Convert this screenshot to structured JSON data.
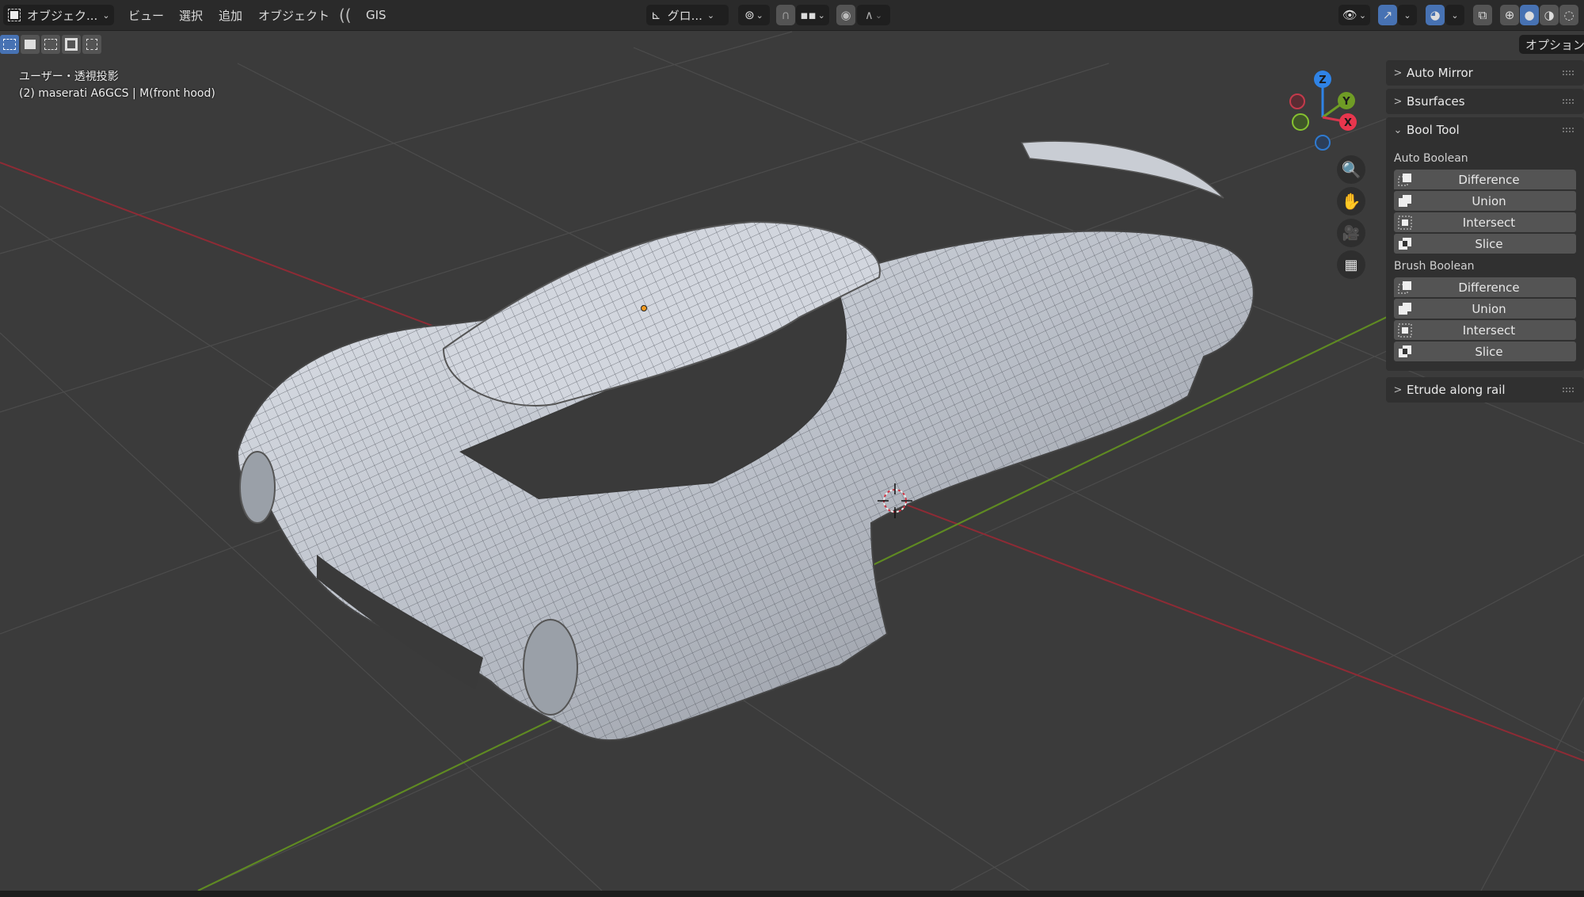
{
  "header": {
    "mode_selector": {
      "icon": "object-mode-icon",
      "label": "オブジェク...",
      "dropdown": true
    },
    "menus": [
      "ビュー",
      "選択",
      "追加",
      "オブジェクト"
    ],
    "addon_icon": "gis-addon-icon",
    "addon_label": "GIS",
    "transform_orientation": {
      "icon": "transform-orientation-icon",
      "label": "グロ..."
    },
    "pivot_icon": "pivot-point-icon",
    "snap_icon": "snap-magnet-icon",
    "snap_target_icon": "snap-increment-icon",
    "proportional_icon": "proportional-editing-icon",
    "falloff_icon": "falloff-curve-icon",
    "visibility_icon": "object-visibility-icon",
    "gizmo_toggle_icon": "gizmo-toggle-icon",
    "overlay_toggle_icon": "overlay-toggle-icon",
    "xray_icon": "xray-icon",
    "shading_modes": [
      {
        "name": "wireframe",
        "active": false
      },
      {
        "name": "solid",
        "active": true
      },
      {
        "name": "material-preview",
        "active": false
      },
      {
        "name": "rendered",
        "active": false
      }
    ]
  },
  "select_modes": [
    {
      "name": "select-new",
      "active": true
    },
    {
      "name": "select-extend",
      "active": false
    },
    {
      "name": "select-subtract",
      "active": false
    },
    {
      "name": "select-invert",
      "active": false
    },
    {
      "name": "select-intersect",
      "active": false
    }
  ],
  "options_label": "オプション",
  "viewport": {
    "view_name": "ユーザー・透視投影",
    "object_info": "(2) maserati A6GCS | M(front hood)",
    "axis_colors": {
      "x": "#d6364d",
      "y": "#6f9c25",
      "z": "#2f83e6"
    }
  },
  "gizmo": {
    "axes": [
      "Z",
      "Y",
      "X"
    ]
  },
  "nav_buttons": [
    {
      "name": "zoom-icon"
    },
    {
      "name": "pan-hand-icon"
    },
    {
      "name": "camera-view-icon"
    },
    {
      "name": "ortho-grid-icon"
    }
  ],
  "npanel": {
    "panels": [
      {
        "title": "Auto Mirror",
        "expanded": false
      },
      {
        "title": "Bsurfaces",
        "expanded": false
      },
      {
        "title": "Bool Tool",
        "expanded": true
      },
      {
        "title": "Etrude along rail",
        "expanded": false
      }
    ],
    "bool_tool": {
      "sections": [
        {
          "label": "Auto Boolean",
          "buttons": [
            "Difference",
            "Union",
            "Intersect",
            "Slice"
          ]
        },
        {
          "label": "Brush Boolean",
          "buttons": [
            "Difference",
            "Union",
            "Intersect",
            "Slice"
          ]
        }
      ]
    }
  }
}
